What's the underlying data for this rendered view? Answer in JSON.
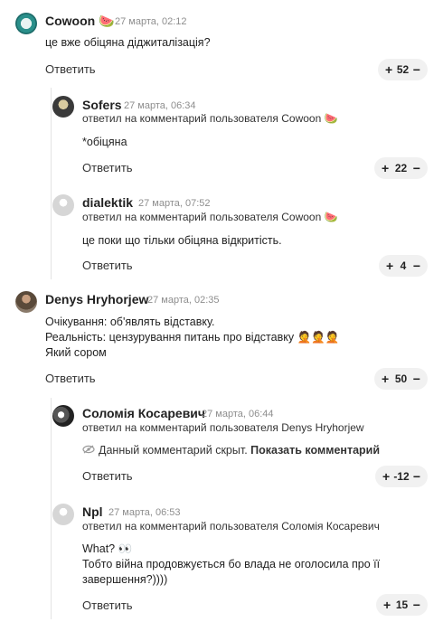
{
  "reply_label": "Ответить",
  "replied_prefix": "ответил на комментарий пользователя",
  "comments": [
    {
      "author": "Cowoon",
      "badge": "🍉",
      "time": "27 марта, 02:12",
      "text": "це вже обіцяна діджиталізація?",
      "votes": "52",
      "avatar": "green"
    },
    {
      "author": "Sofers",
      "time": "27 марта, 06:34",
      "replied_to": "Cowoon",
      "replied_badge": "🍉",
      "text": "*обіцяна",
      "votes": "22",
      "avatar": "dark"
    },
    {
      "author": "dialektik",
      "time": "27 марта, 07:52",
      "replied_to": "Cowoon",
      "replied_badge": "🍉",
      "text": "це поки що тільки обіцяна відкритість.",
      "votes": "4",
      "avatar": "gray"
    },
    {
      "author": "Denys Hryhorjew",
      "time": "27 марта, 02:35",
      "text_lines": [
        "Очікування: об'являть відставку.",
        "Реальність: цензурування питань про відставку 🤦🤦🤦",
        "Який сором"
      ],
      "votes": "50",
      "avatar": "person"
    },
    {
      "author": "Соломія Косаревич",
      "time": "27 марта, 06:44",
      "replied_to": "Denys Hryhorjew",
      "hidden_text": "Данный комментарий скрыт.",
      "show_link": "Показать комментарий",
      "votes": "-12",
      "avatar": "bw"
    },
    {
      "author": "Npl",
      "time": "27 марта, 06:53",
      "replied_to": "Соломія Косаревич",
      "text_lines": [
        "What? 👀",
        "Тобто війна продовжується бо влада не оголосила про її",
        "завершення?))))"
      ],
      "votes": "15",
      "avatar": "gray"
    }
  ]
}
